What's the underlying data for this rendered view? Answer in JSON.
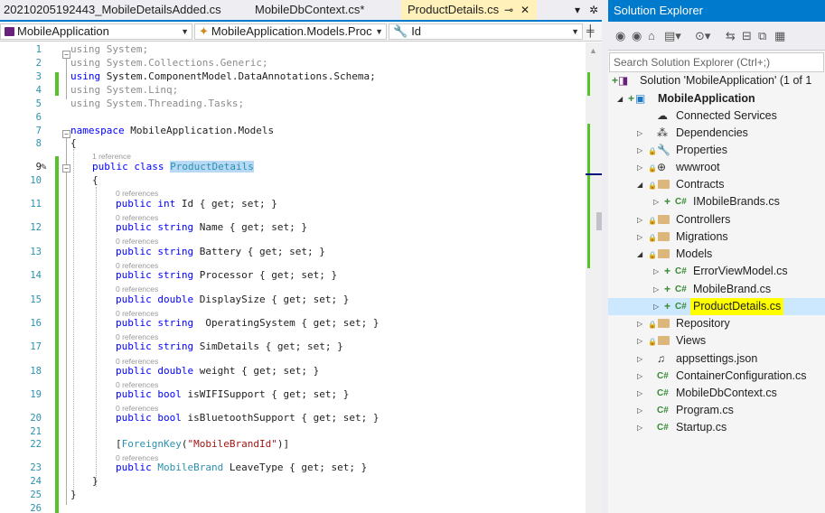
{
  "tabs": [
    {
      "label": "20210205192443_MobileDetailsAdded.cs",
      "active": false
    },
    {
      "label": "MobileDbContext.cs*",
      "active": false
    },
    {
      "label": "ProductDetails.cs",
      "active": true
    }
  ],
  "tab_controls": {
    "pin": "⊸",
    "close": "✕",
    "dropdown": "▾",
    "settings": "✲"
  },
  "navbar": {
    "project": "MobileApplication",
    "type": "MobileApplication.Models.Proc",
    "member": "Id"
  },
  "code": {
    "line_numbers": [
      "1",
      "2",
      "3",
      "4",
      "5",
      "6",
      "7",
      "8",
      "9",
      "10",
      "11",
      "12",
      "13",
      "14",
      "15",
      "16",
      "17",
      "18",
      "19",
      "20",
      "21",
      "22",
      "23",
      "24",
      "25",
      "26"
    ],
    "usings": [
      "System;",
      "System.Collections.Generic;",
      "System.ComponentModel.DataAnnotations.Schema;",
      "System.Linq;",
      "System.Threading.Tasks;"
    ],
    "kw_using": "using",
    "kw_namespace": "namespace",
    "namespace_name": "MobileApplication.Models",
    "open_brace": "{",
    "close_brace": "}",
    "class_refs": "1 reference",
    "kw_public": "public",
    "kw_class": "class",
    "class_name": "ProductDetails",
    "prop_refs": "0 references",
    "properties": [
      {
        "type": "int",
        "name": "Id",
        "accessors": "{ get; set; }"
      },
      {
        "type": "string",
        "name": "Name",
        "accessors": "{ get; set; }"
      },
      {
        "type": "string",
        "name": "Battery",
        "accessors": "{ get; set; }"
      },
      {
        "type": "string",
        "name": "Processor",
        "accessors": "{ get; set; }"
      },
      {
        "type": "double",
        "name": "DisplaySize",
        "accessors": "{ get; set; }"
      },
      {
        "type": "string",
        "name": " OperatingSystem",
        "accessors": "{ get; set; }"
      },
      {
        "type": "string",
        "name": "SimDetails",
        "accessors": "{ get; set; }"
      },
      {
        "type": "double",
        "name": "weight",
        "accessors": "{ get; set; }"
      },
      {
        "type": "bool",
        "name": "isWIFISupport",
        "accessors": "{ get; set; }"
      },
      {
        "type": "bool",
        "name": "isBluetoothSupport",
        "accessors": "{ get; set; }"
      }
    ],
    "attribute_open": "[",
    "attribute_name": "ForeignKey",
    "attribute_arg": "\"MobileBrandId\"",
    "attribute_close": ")]",
    "attribute_paren": "(",
    "last_prop": {
      "type": "MobileBrand",
      "name": "LeaveType",
      "accessors": "{ get; set; }"
    }
  },
  "solution_explorer": {
    "title": "Solution Explorer",
    "search_placeholder": "Search Solution Explorer (Ctrl+;)",
    "solution": "Solution 'MobileApplication' (1 of 1",
    "project": "MobileApplication",
    "items": [
      {
        "label": "Connected Services",
        "icon": "connected-services-icon"
      },
      {
        "label": "Dependencies",
        "icon": "dependencies-icon"
      },
      {
        "label": "Properties",
        "icon": "properties-icon"
      },
      {
        "label": "wwwroot",
        "icon": "globe-icon"
      },
      {
        "label": "Contracts",
        "icon": "folder-icon"
      },
      {
        "label": "IMobileBrands.cs",
        "icon": "csharp-file-icon"
      },
      {
        "label": "Controllers",
        "icon": "folder-icon"
      },
      {
        "label": "Migrations",
        "icon": "folder-icon"
      },
      {
        "label": "Models",
        "icon": "folder-icon"
      },
      {
        "label": "ErrorViewModel.cs",
        "icon": "csharp-file-icon"
      },
      {
        "label": "MobileBrand.cs",
        "icon": "csharp-file-icon"
      },
      {
        "label": "ProductDetails.cs",
        "icon": "csharp-file-icon"
      },
      {
        "label": "Repository",
        "icon": "folder-icon"
      },
      {
        "label": "Views",
        "icon": "folder-icon"
      },
      {
        "label": "appsettings.json",
        "icon": "json-file-icon"
      },
      {
        "label": "ContainerConfiguration.cs",
        "icon": "csharp-file-icon"
      },
      {
        "label": "MobileDbContext.cs",
        "icon": "csharp-file-icon"
      },
      {
        "label": "Program.cs",
        "icon": "csharp-file-icon"
      },
      {
        "label": "Startup.cs",
        "icon": "csharp-file-icon"
      }
    ],
    "cs_glyph": "C#"
  },
  "colors": {
    "accent": "#007acc",
    "change_bar": "#57c22b",
    "keyword": "#0000ff",
    "type": "#2b91af",
    "string": "#a31515",
    "highlight": "#ffff00"
  }
}
